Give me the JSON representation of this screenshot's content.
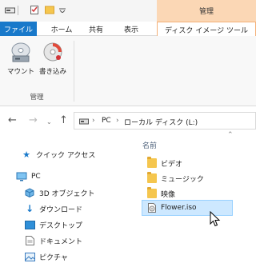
{
  "title_bar": {
    "context_group_label": "管理"
  },
  "ribbon_tabs": {
    "file": "ファイル",
    "home": "ホーム",
    "share": "共有",
    "view": "表示",
    "disc_image_tools": "ディスク イメージ ツール"
  },
  "ribbon": {
    "mount_label": "マウント",
    "burn_label": "書き込み",
    "group_label": "管理"
  },
  "address": {
    "crumbs": [
      "PC",
      "ローカル ディスク (L:)"
    ]
  },
  "nav_pane": {
    "quick_access": "クイック アクセス",
    "pc": "PC",
    "objects_3d": "3D オブジェクト",
    "downloads": "ダウンロード",
    "desktop": "デスクトップ",
    "documents": "ドキュメント",
    "pictures": "ピクチャ"
  },
  "file_list": {
    "column_name": "名前",
    "items": [
      {
        "name": "ビデオ",
        "type": "folder"
      },
      {
        "name": "ミュージック",
        "type": "folder"
      },
      {
        "name": "映像",
        "type": "folder"
      },
      {
        "name": "Flower.iso",
        "type": "disc-image",
        "selected": true
      }
    ]
  },
  "colors": {
    "file_tab": "#1979ca",
    "context_tab": "#fbd7b5",
    "selection": "#cde8ff"
  }
}
